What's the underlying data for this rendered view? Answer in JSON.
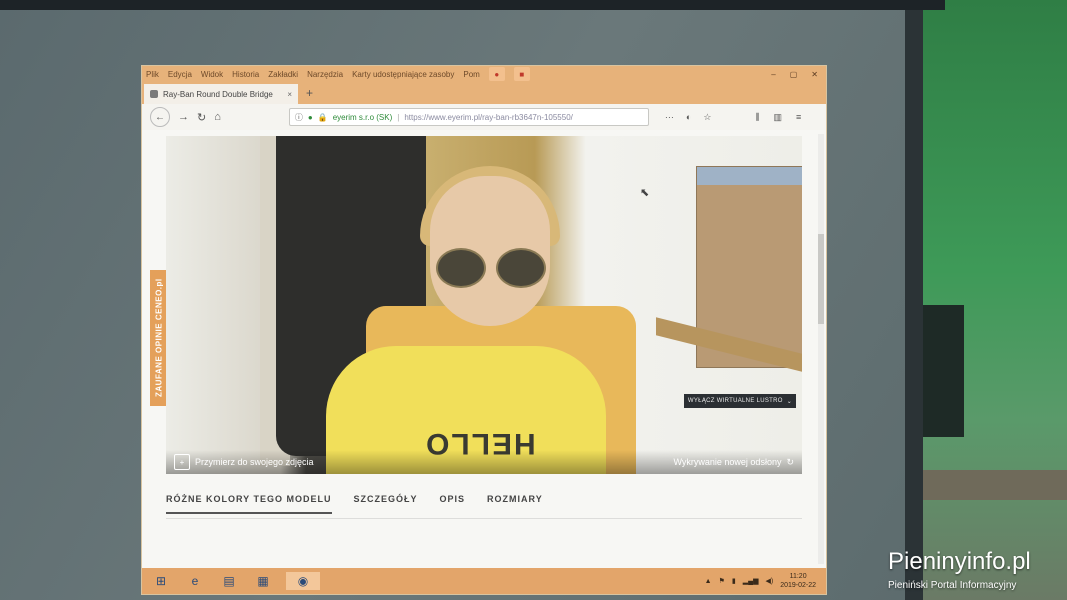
{
  "menubar": {
    "items": [
      "Plik",
      "Edycja",
      "Widok",
      "Historia",
      "Zakładki",
      "Narzędzia",
      "Karty udostępniające zasoby",
      "Pom"
    ]
  },
  "tab": {
    "title": "Ray-Ban Round Double Bridge",
    "close": "×",
    "new_tab": "+"
  },
  "navbar": {
    "site_identity": "eyerim s.r.o (SK)",
    "url": "https://www.eyerim.pl/ray-ban-rb3647n-105550/",
    "more": "···"
  },
  "page": {
    "side_badge": "ZAUFANE OPINIE CENEO.pl",
    "mirror_button": "WYŁĄCZ WIRTUALNE LUSTRO",
    "try_photo_label": "Przymierz do swojego zdjęcia",
    "face_detect_label": "Wykrywanie nowej odsłony",
    "hoodie_text": "HELLO",
    "tabs": [
      "RÓŻNE KOLORY TEGO MODELU",
      "SZCZEGÓŁY",
      "OPIS",
      "ROZMIARY"
    ]
  },
  "taskbar": {
    "time": "11:20",
    "date": "2019-02-22"
  },
  "watermark": {
    "title": "Pieninyinfo.pl",
    "subtitle": "Pieniński Portal Informacyjny"
  }
}
